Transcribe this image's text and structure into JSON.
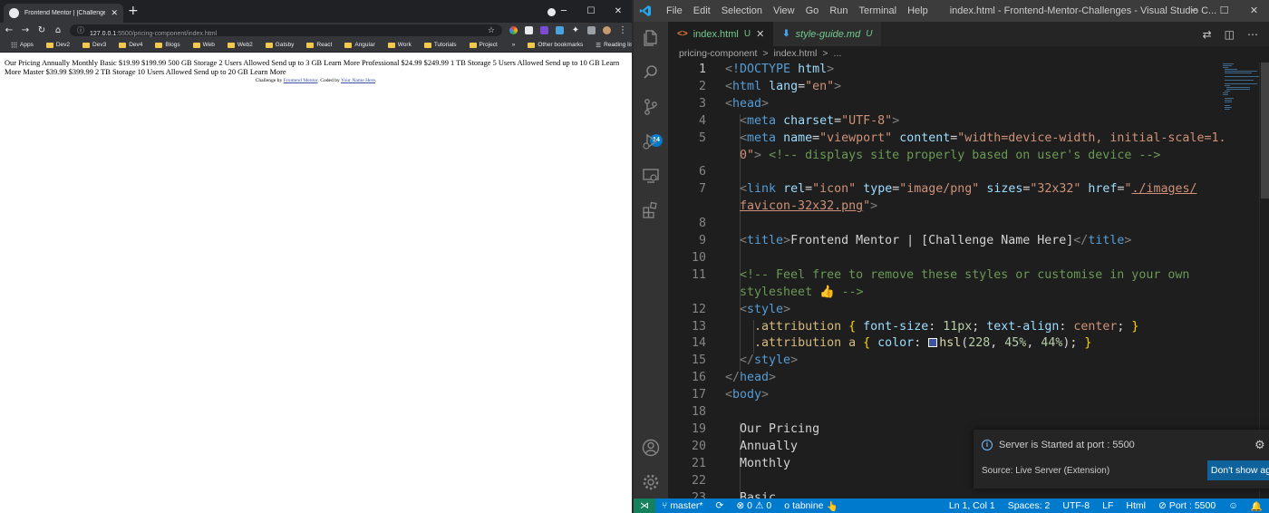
{
  "chrome": {
    "tab_title": "Frontend Mentor | [Challenge Na",
    "url_host": "127.0.0.1",
    "url_path": ":5500/pricing-component/index.html",
    "bookmarks": [
      "Apps",
      "Dev2",
      "Dev3",
      "Dev4",
      "Blogs",
      "Web",
      "Web2",
      "Gatsby",
      "React",
      "Angular",
      "Work",
      "Tutorials",
      "Project"
    ],
    "bookmarks_overflow": "»",
    "other_bookmarks": "Other bookmarks",
    "reading_list": "Reading list",
    "page_text": "Our Pricing Annually Monthly Basic $19.99 $199.99 500 GB Storage 2 Users Allowed Send up to 3 GB Learn More Professional $24.99 $249.99 1 TB Storage 5 Users Allowed Send up to 10 GB Learn More Master $39.99 $399.99 2 TB Storage 10 Users Allowed Send up to 20 GB Learn More",
    "attribution_prefix": "Challenge by ",
    "attribution_link1": "Frontend Mentor",
    "attribution_mid": ". Coded by ",
    "attribution_link2": "Your Name Here",
    "attribution_suffix": "."
  },
  "vscode": {
    "menu": [
      "File",
      "Edit",
      "Selection",
      "View",
      "Go",
      "Run",
      "Terminal",
      "Help"
    ],
    "window_title": "index.html - Frontend-Mentor-Challenges - Visual Studio C...",
    "scm_badge": "14",
    "tabs": [
      {
        "label": "index.html",
        "status": "U",
        "icon": "<>"
      },
      {
        "label": "style-guide.md",
        "status": "U",
        "icon": "⬇"
      }
    ],
    "breadcrumb": [
      "pricing-component",
      ">",
      "index.html",
      ">",
      "..."
    ],
    "line_numbers": [
      "1",
      "2",
      "3",
      "4",
      "5",
      "",
      "6",
      "7",
      "",
      "8",
      "9",
      "10",
      "11",
      "",
      "12",
      "13",
      "14",
      "15",
      "16",
      "17",
      "18",
      "19",
      "20",
      "21",
      "22",
      "23"
    ],
    "notification": {
      "message": "Server is Started at port : 5500",
      "source": "Source: Live Server (Extension)",
      "button": "Don't show again"
    },
    "status": {
      "branch": "master*",
      "errors": "0",
      "warnings": "0",
      "tabnine": "tabnine",
      "position": "Ln 1, Col 1",
      "spaces": "Spaces: 2",
      "encoding": "UTF-8",
      "eol": "LF",
      "language": "Html",
      "port": "Port : 5500"
    }
  },
  "code_lines": [
    [
      [
        "t-ang",
        "<"
      ],
      [
        "t-tag",
        "!DOCTYPE"
      ],
      [
        "t-text",
        " "
      ],
      [
        "t-attr",
        "html"
      ],
      [
        "t-ang",
        ">"
      ]
    ],
    [
      [
        "t-ang",
        "<"
      ],
      [
        "t-tag",
        "html"
      ],
      [
        "t-text",
        " "
      ],
      [
        "t-attr",
        "lang"
      ],
      [
        "t-text",
        "="
      ],
      [
        "t-str",
        "\"en\""
      ],
      [
        "t-ang",
        ">"
      ]
    ],
    [
      [
        "t-ang",
        "<"
      ],
      [
        "t-tag",
        "head"
      ],
      [
        "t-ang",
        ">"
      ]
    ],
    [
      [
        "t-text",
        "  "
      ],
      [
        "t-ang",
        "<"
      ],
      [
        "t-tag",
        "meta"
      ],
      [
        "t-text",
        " "
      ],
      [
        "t-attr",
        "charset"
      ],
      [
        "t-text",
        "="
      ],
      [
        "t-str",
        "\"UTF-8\""
      ],
      [
        "t-ang",
        ">"
      ]
    ],
    [
      [
        "t-text",
        "  "
      ],
      [
        "t-ang",
        "<"
      ],
      [
        "t-tag",
        "meta"
      ],
      [
        "t-text",
        " "
      ],
      [
        "t-attr",
        "name"
      ],
      [
        "t-text",
        "="
      ],
      [
        "t-str",
        "\"viewport\""
      ],
      [
        "t-text",
        " "
      ],
      [
        "t-attr",
        "content"
      ],
      [
        "t-text",
        "="
      ],
      [
        "t-str",
        "\"width=device-width, initial-scale=1."
      ]
    ],
    [
      [
        "t-text",
        "  "
      ],
      [
        "t-str",
        "0\""
      ],
      [
        "t-ang",
        ">"
      ],
      [
        "t-text",
        " "
      ],
      [
        "t-com",
        "<!-- displays site properly based on user's device -->"
      ]
    ],
    [],
    [
      [
        "t-text",
        "  "
      ],
      [
        "t-ang",
        "<"
      ],
      [
        "t-tag",
        "link"
      ],
      [
        "t-text",
        " "
      ],
      [
        "t-attr",
        "rel"
      ],
      [
        "t-text",
        "="
      ],
      [
        "t-str",
        "\"icon\""
      ],
      [
        "t-text",
        " "
      ],
      [
        "t-attr",
        "type"
      ],
      [
        "t-text",
        "="
      ],
      [
        "t-str",
        "\"image/png\""
      ],
      [
        "t-text",
        " "
      ],
      [
        "t-attr",
        "sizes"
      ],
      [
        "t-text",
        "="
      ],
      [
        "t-str",
        "\"32x32\""
      ],
      [
        "t-text",
        " "
      ],
      [
        "t-attr",
        "href"
      ],
      [
        "t-text",
        "="
      ],
      [
        "t-str",
        "\""
      ],
      [
        "t-link",
        "./images/"
      ]
    ],
    [
      [
        "t-text",
        "  "
      ],
      [
        "t-link",
        "favicon-32x32.png"
      ],
      [
        "t-str",
        "\""
      ],
      [
        "t-ang",
        ">"
      ]
    ],
    [],
    [
      [
        "t-text",
        "  "
      ],
      [
        "t-ang",
        "<"
      ],
      [
        "t-tag",
        "title"
      ],
      [
        "t-ang",
        ">"
      ],
      [
        "t-text",
        "Frontend Mentor | [Challenge Name Here]"
      ],
      [
        "t-ang",
        "</"
      ],
      [
        "t-tag",
        "title"
      ],
      [
        "t-ang",
        ">"
      ]
    ],
    [],
    [
      [
        "t-text",
        "  "
      ],
      [
        "t-com",
        "<!-- Feel free to remove these styles or customise in your own"
      ]
    ],
    [
      [
        "t-text",
        "  "
      ],
      [
        "t-com",
        "stylesheet 👍 -->"
      ]
    ],
    [
      [
        "t-text",
        "  "
      ],
      [
        "t-ang",
        "<"
      ],
      [
        "t-tag",
        "style"
      ],
      [
        "t-ang",
        ">"
      ]
    ],
    [
      [
        "t-text",
        "    "
      ],
      [
        "t-sel",
        ".attribution"
      ],
      [
        "t-text",
        " "
      ],
      [
        "t-brace",
        "{"
      ],
      [
        "t-text",
        " "
      ],
      [
        "t-prop",
        "font-size"
      ],
      [
        "t-text",
        ": "
      ],
      [
        "t-num",
        "11px"
      ],
      [
        "t-text",
        "; "
      ],
      [
        "t-prop",
        "text-align"
      ],
      [
        "t-text",
        ": "
      ],
      [
        "t-str",
        "center"
      ],
      [
        "t-text",
        "; "
      ],
      [
        "t-brace",
        "}"
      ]
    ],
    [
      [
        "t-text",
        "    "
      ],
      [
        "t-sel",
        ".attribution a"
      ],
      [
        "t-text",
        " "
      ],
      [
        "t-brace",
        "{"
      ],
      [
        "t-text",
        " "
      ],
      [
        "t-prop",
        "color"
      ],
      [
        "t-text",
        ": "
      ],
      [
        "swatch",
        ""
      ],
      [
        "t-fn",
        "hsl"
      ],
      [
        "t-text",
        "("
      ],
      [
        "t-num",
        "228"
      ],
      [
        "t-text",
        ", "
      ],
      [
        "t-num",
        "45%"
      ],
      [
        "t-text",
        ", "
      ],
      [
        "t-num",
        "44%"
      ],
      [
        "t-text",
        "); "
      ],
      [
        "t-brace",
        "}"
      ]
    ],
    [
      [
        "t-text",
        "  "
      ],
      [
        "t-ang",
        "</"
      ],
      [
        "t-tag",
        "style"
      ],
      [
        "t-ang",
        ">"
      ]
    ],
    [
      [
        "t-ang",
        "</"
      ],
      [
        "t-tag",
        "head"
      ],
      [
        "t-ang",
        ">"
      ]
    ],
    [
      [
        "t-ang",
        "<"
      ],
      [
        "t-tag",
        "body"
      ],
      [
        "t-ang",
        ">"
      ]
    ],
    [],
    [
      [
        "t-text",
        "  Our Pricing"
      ]
    ],
    [
      [
        "t-text",
        "  Annually"
      ]
    ],
    [
      [
        "t-text",
        "  Monthly"
      ]
    ],
    [],
    [
      [
        "t-text",
        "  Basic"
      ]
    ]
  ]
}
